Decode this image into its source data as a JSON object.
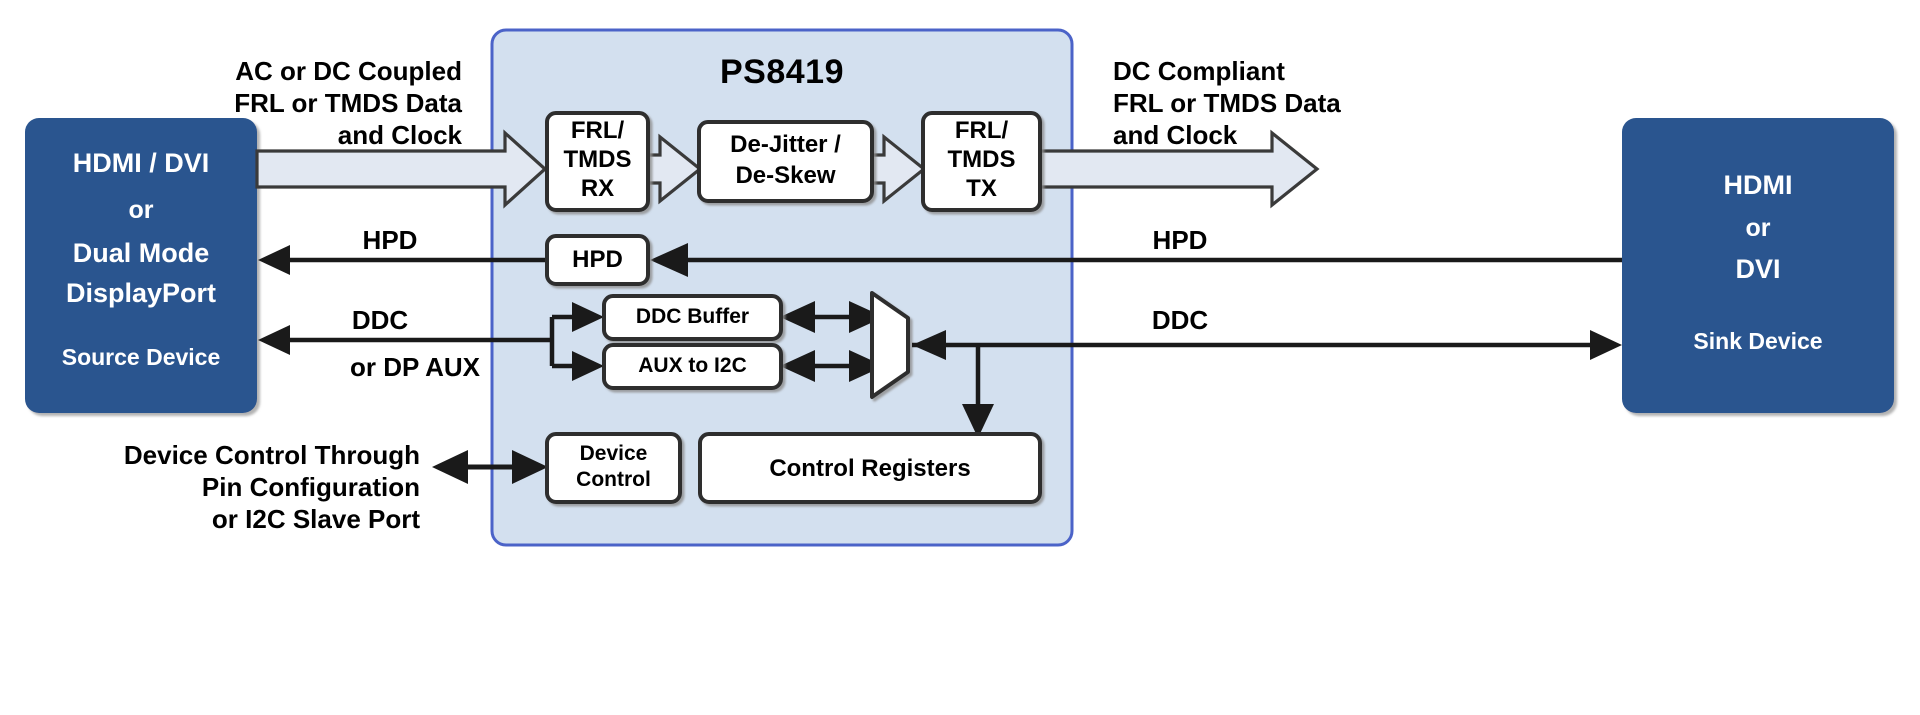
{
  "diagram": {
    "title": "PS8419",
    "chip": {
      "label": "PS8419",
      "fill": "#d3e0ef",
      "border": "#4b63c8"
    },
    "source_device": {
      "name": "source-device",
      "lines": [
        "HDMI / DVI",
        "or",
        "Dual Mode",
        "DisplayPort"
      ],
      "footer": "Source Device",
      "fill": "#2b558f"
    },
    "sink_device": {
      "name": "sink-device",
      "lines": [
        "HDMI",
        "or",
        "DVI"
      ],
      "footer": "Sink Device",
      "fill": "#2b558f"
    },
    "left_labels": {
      "data_path": [
        "AC or DC Coupled",
        "FRL or TMDS Data",
        "and Clock"
      ],
      "hpd": "HPD",
      "ddc": "DDC",
      "dp_aux": "or DP AUX",
      "device_control": [
        "Device Control Through",
        "Pin Configuration",
        "or I2C Slave Port"
      ]
    },
    "right_labels": {
      "data_path": [
        "DC Compliant",
        "FRL or TMDS Data",
        "and Clock"
      ],
      "hpd": "HPD",
      "ddc": "DDC"
    },
    "blocks": [
      {
        "id": "frl-tmds-rx",
        "lines": [
          "FRL/",
          "TMDS",
          "RX"
        ]
      },
      {
        "id": "de-jitter-skew",
        "lines": [
          "De-Jitter /",
          "De-Skew"
        ]
      },
      {
        "id": "frl-tmds-tx",
        "lines": [
          "FRL/",
          "TMDS",
          "TX"
        ]
      },
      {
        "id": "hpd",
        "lines": [
          "HPD"
        ]
      },
      {
        "id": "ddc-buffer",
        "lines": [
          "DDC Buffer"
        ]
      },
      {
        "id": "aux-to-i2c",
        "lines": [
          "AUX to I2C"
        ]
      },
      {
        "id": "device-control",
        "lines": [
          "Device",
          "Control"
        ]
      },
      {
        "id": "control-registers",
        "lines": [
          "Control Registers"
        ]
      }
    ],
    "mux": {
      "id": "ddc-aux-mux",
      "label": ""
    },
    "colors": {
      "arrow_fill": "#e2e8f2",
      "stroke": "#3a3a3a",
      "line": "#1a1a1a",
      "block_fill": "#ffffff",
      "white": "#ffffff"
    }
  }
}
